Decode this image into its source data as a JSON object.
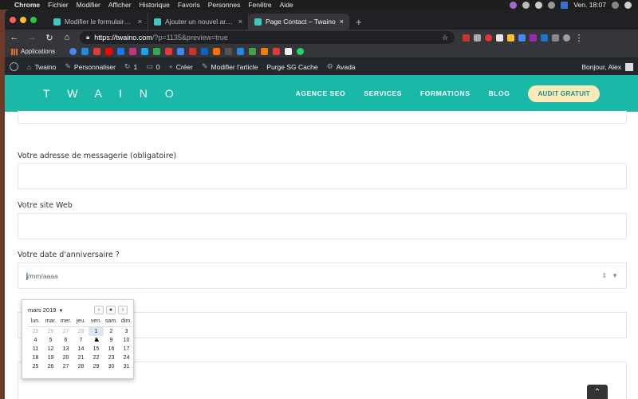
{
  "menubar": {
    "app": "Chrome",
    "items": [
      "Fichier",
      "Modifier",
      "Afficher",
      "Historique",
      "Favoris",
      "Personnes",
      "Fenêtre",
      "Aide"
    ],
    "clock": "Ven. 18:07"
  },
  "tabs": [
    {
      "label": "Modifier le formulaire de conta",
      "close": "×"
    },
    {
      "label": "Ajouter un nouvel article ‹ Twa",
      "close": "×"
    },
    {
      "label": "Page Contact – Twaino",
      "close": "×"
    }
  ],
  "new_tab": "+",
  "address": {
    "host": "https://twaino.com",
    "path": "/?p=1135&preview=true"
  },
  "bookmarks": {
    "apps_label": "Applications"
  },
  "wp_admin_bar": {
    "site": "Twaino",
    "customize": "Personnaliser",
    "updates": "1",
    "comments": "0",
    "new": "Créer",
    "edit": "Modifier l'article",
    "purge": "Purge SG Cache",
    "avada": "Avada",
    "greeting": "Bonjour, Alex"
  },
  "site_header": {
    "logo": "T W A I N O",
    "nav": [
      "AGENCE SEO",
      "SERVICES",
      "FORMATIONS",
      "BLOG"
    ],
    "cta": "AUDIT GRATUIT"
  },
  "form": {
    "email_label": "Votre adresse de messagerie (obligatoire)",
    "website_label": "Votre site Web",
    "birthday_label": "Votre date d'anniversaire ?",
    "date_cursor": "j",
    "date_placeholder": "j/mm/aaaa",
    "date_rest": "/mm/aaaa"
  },
  "datepicker": {
    "month": "mars 2019",
    "weekdays": [
      "lun.",
      "mar.",
      "mer.",
      "jeu.",
      "ven.",
      "sam.",
      "dim."
    ],
    "weeks": [
      [
        "25",
        "26",
        "27",
        "28",
        "1",
        "2",
        "3"
      ],
      [
        "4",
        "5",
        "6",
        "7",
        "8",
        "9",
        "10"
      ],
      [
        "11",
        "12",
        "13",
        "14",
        "15",
        "16",
        "17"
      ],
      [
        "18",
        "19",
        "20",
        "21",
        "22",
        "23",
        "24"
      ],
      [
        "25",
        "26",
        "27",
        "28",
        "29",
        "30",
        "31"
      ]
    ],
    "prev": "‹",
    "today_btn": "●",
    "next": "›"
  },
  "colors": {
    "header_bg": "#1ab8a6",
    "cta_bg": "#fbe9b7",
    "wpbar_bg": "#23282d"
  }
}
